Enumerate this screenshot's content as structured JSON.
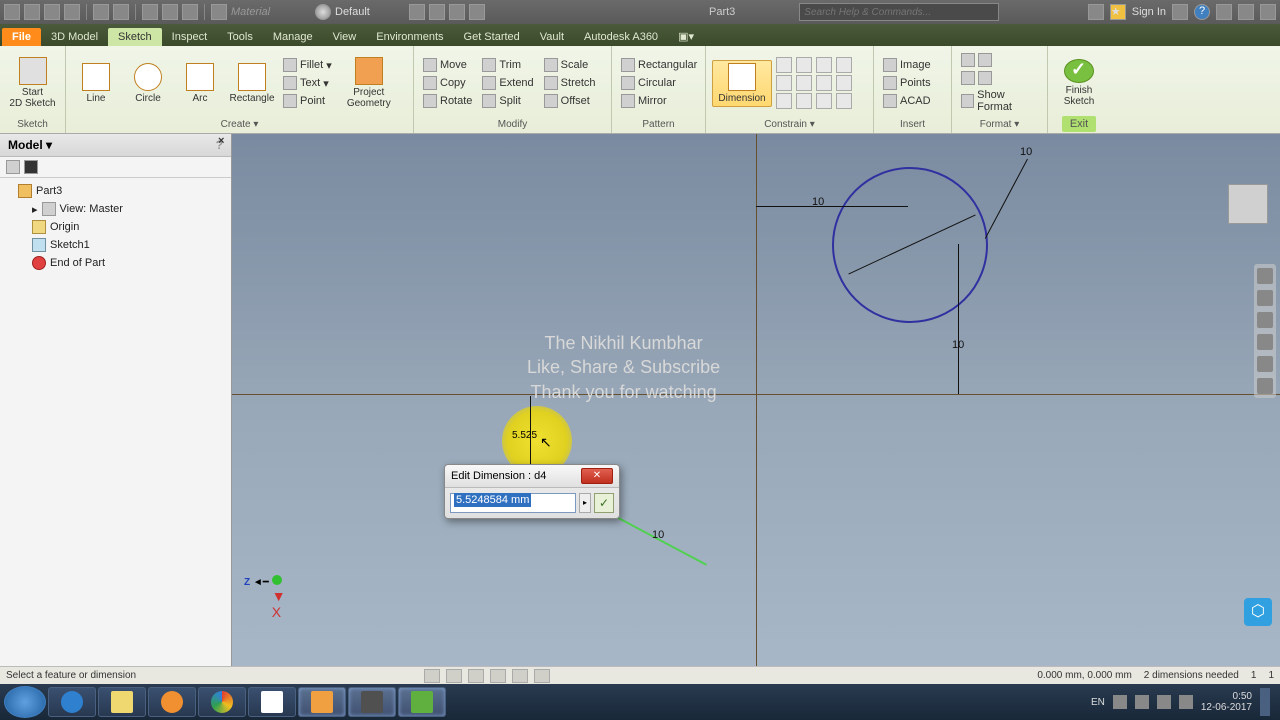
{
  "qat": {
    "app_dropdown": "Material",
    "appearance": "Default",
    "doc_title": "Part3",
    "search_placeholder": "Search Help & Commands...",
    "signin": "Sign In"
  },
  "tabs": {
    "file": "File",
    "items": [
      "3D Model",
      "Sketch",
      "Inspect",
      "Tools",
      "Manage",
      "View",
      "Environments",
      "Get Started",
      "Vault",
      "Autodesk A360"
    ],
    "active": "Sketch"
  },
  "ribbon": {
    "sketch_panel": {
      "title": "Sketch",
      "start": "Start\n2D Sketch"
    },
    "create_panel": {
      "title": "Create ▾",
      "line": "Line",
      "circle": "Circle",
      "arc": "Arc",
      "rectangle": "Rectangle",
      "fillet": "Fillet",
      "text": "Text",
      "point": "Point",
      "geometry": "Project\nGeometry"
    },
    "modify_panel": {
      "title": "Modify",
      "move": "Move",
      "copy": "Copy",
      "rotate": "Rotate",
      "trim": "Trim",
      "extend": "Extend",
      "split": "Split",
      "scale": "Scale",
      "stretch": "Stretch",
      "offset": "Offset"
    },
    "pattern_panel": {
      "title": "Pattern",
      "rect": "Rectangular",
      "circ": "Circular",
      "mirror": "Mirror"
    },
    "constrain_panel": {
      "title": "Constrain ▾",
      "dimension": "Dimension"
    },
    "insert_panel": {
      "title": "Insert",
      "image": "Image",
      "points": "Points",
      "acad": "ACAD"
    },
    "format_panel": {
      "title": "Format ▾",
      "show": "Show Format"
    },
    "exit_panel": {
      "title": "Exit",
      "finish": "Finish\nSketch"
    }
  },
  "browser": {
    "header": "Model ▾",
    "items": {
      "part": "Part3",
      "view": "View: Master",
      "origin": "Origin",
      "sketch": "Sketch1",
      "end": "End of Part"
    }
  },
  "canvas": {
    "watermark_l1": "The Nikhil Kumbhar",
    "watermark_l2": "Like, Share & Subscribe",
    "watermark_l3": "Thank you for watching",
    "dim_top": "10",
    "dim_h": "10",
    "dim_v": "10",
    "dim_line": "10",
    "dim_edit": "5.525"
  },
  "dialog": {
    "title": "Edit Dimension : d4",
    "value": "5.5248584 mm",
    "close": "✕",
    "ok": "✓",
    "arrow": "▸"
  },
  "status": {
    "prompt": "Select a feature or dimension",
    "coords": "0.000 mm, 0.000 mm",
    "dims": "2 dimensions needed",
    "n1": "1",
    "n2": "1"
  },
  "tray": {
    "lang": "EN",
    "time": "0:50",
    "date": "12-06-2017"
  },
  "coord": {
    "z": "Z",
    "x": "X"
  }
}
